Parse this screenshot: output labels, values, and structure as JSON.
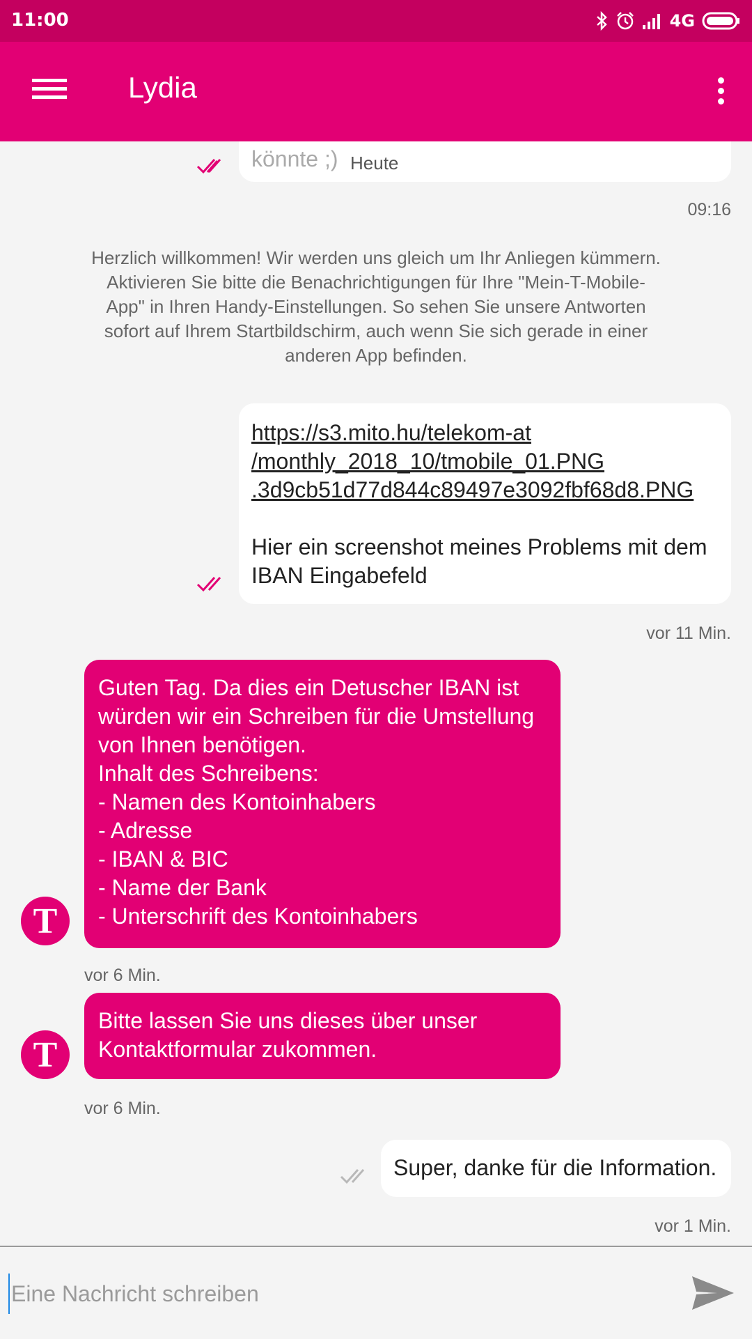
{
  "status_bar": {
    "time": "11:00",
    "network": "4G"
  },
  "app_bar": {
    "title": "Lydia"
  },
  "messages": [
    {
      "type": "outgoing",
      "text_partial": "könnte ;)",
      "meta": "Heute"
    },
    {
      "type": "timestamp",
      "text": "09:16"
    },
    {
      "type": "system",
      "text": "Herzlich willkommen! Wir werden uns gleich um Ihr Anliegen kümmern. Aktivieren Sie bitte die Benachrichtigungen für Ihre \"Mein-T-Mobile-App\" in Ihren Handy-Einstellungen. So sehen Sie unsere Antworten sofort auf Ihrem Startbildschirm, auch wenn Sie sich gerade in einer anderen App befinden."
    },
    {
      "type": "outgoing",
      "link_lines": [
        "https://s3.mito.hu/telekom-at",
        "/monthly_2018_10/tmobile_01.PNG",
        ".3d9cb51d77d844c89497e3092fbf68d8.PNG"
      ],
      "text": "Hier ein screenshot meines Problems mit dem IBAN Eingabefeld",
      "time": "vor 11 Min."
    },
    {
      "type": "incoming",
      "text": "Guten Tag. Da dies ein Detuscher IBAN ist würden wir ein Schreiben für die Umstellung von Ihnen benötigen.\nInhalt des Schreibens:\n- Namen des Kontoinhabers\n- Adresse\n- IBAN & BIC\n- Name der Bank\n- Unterschrift des Kontoinhabers",
      "time": "vor 6 Min."
    },
    {
      "type": "incoming",
      "text": "Bitte lassen Sie uns dieses über unser Kontaktformular zukommen.",
      "time": "vor 6 Min."
    },
    {
      "type": "outgoing",
      "text": "Super, danke für die Information.",
      "time": "vor 1 Min."
    }
  ],
  "composer": {
    "placeholder": "Eine Nachricht schreiben"
  },
  "colors": {
    "brand": "#e20074",
    "status_bar": "#c4005f",
    "background": "#f4f4f4"
  },
  "icons": [
    "menu-icon",
    "more-vert-icon",
    "bluetooth-icon",
    "alarm-icon",
    "signal-icon",
    "battery-icon",
    "double-check-icon",
    "telekom-logo",
    "send-icon"
  ]
}
